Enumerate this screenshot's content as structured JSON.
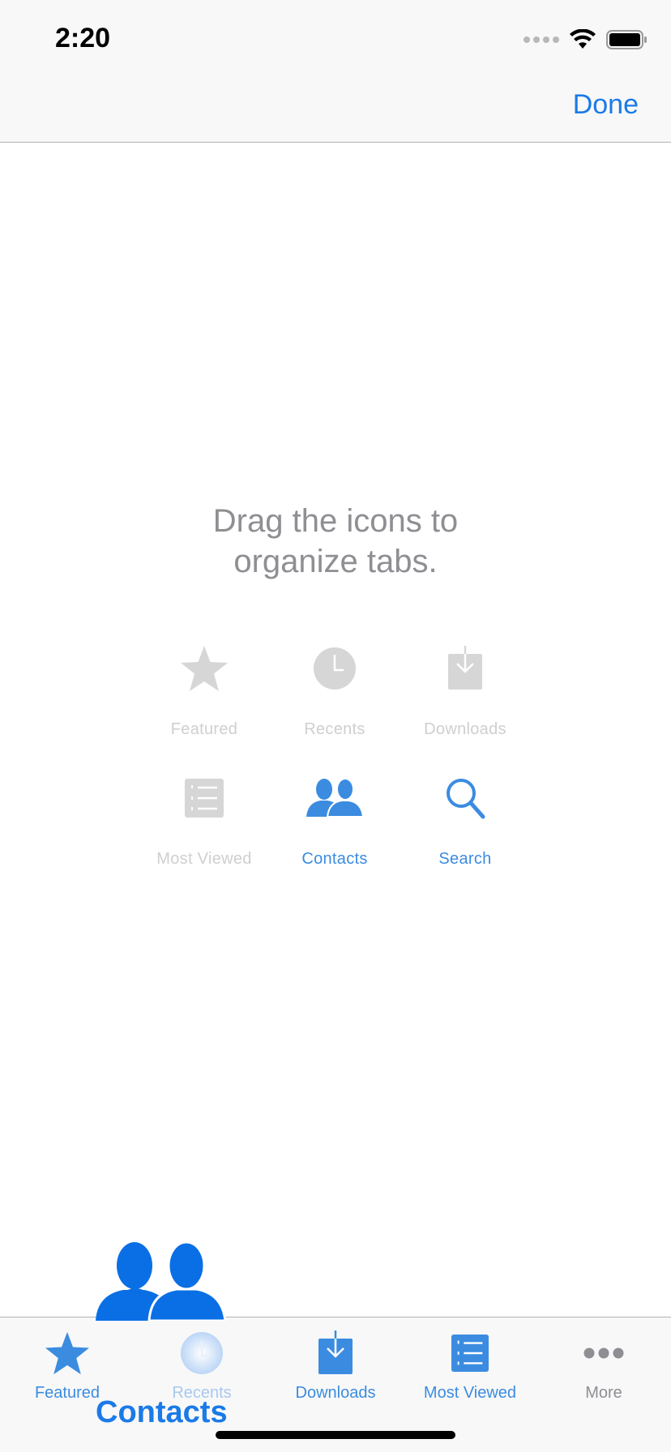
{
  "status_bar": {
    "time": "2:20"
  },
  "nav": {
    "done_label": "Done"
  },
  "instructions": {
    "line1": "Drag the icons to",
    "line2": "organize tabs."
  },
  "grid": {
    "featured": "Featured",
    "recents": "Recents",
    "downloads": "Downloads",
    "most_viewed": "Most Viewed",
    "contacts": "Contacts",
    "search": "Search"
  },
  "tabs": {
    "featured": "Featured",
    "recents": "Recents",
    "downloads": "Downloads",
    "most_viewed": "Most Viewed",
    "more": "More"
  },
  "drag": {
    "label": "Contacts"
  },
  "colors": {
    "accent": "#1a7ae8",
    "tab_active": "#3b8ce0",
    "disabled": "#d4d4d4",
    "text_secondary": "#8e8e93"
  },
  "icons": [
    "star-icon",
    "clock-icon",
    "download-icon",
    "list-icon",
    "contacts-icon",
    "search-icon",
    "more-icon",
    "wifi-icon",
    "battery-icon"
  ]
}
